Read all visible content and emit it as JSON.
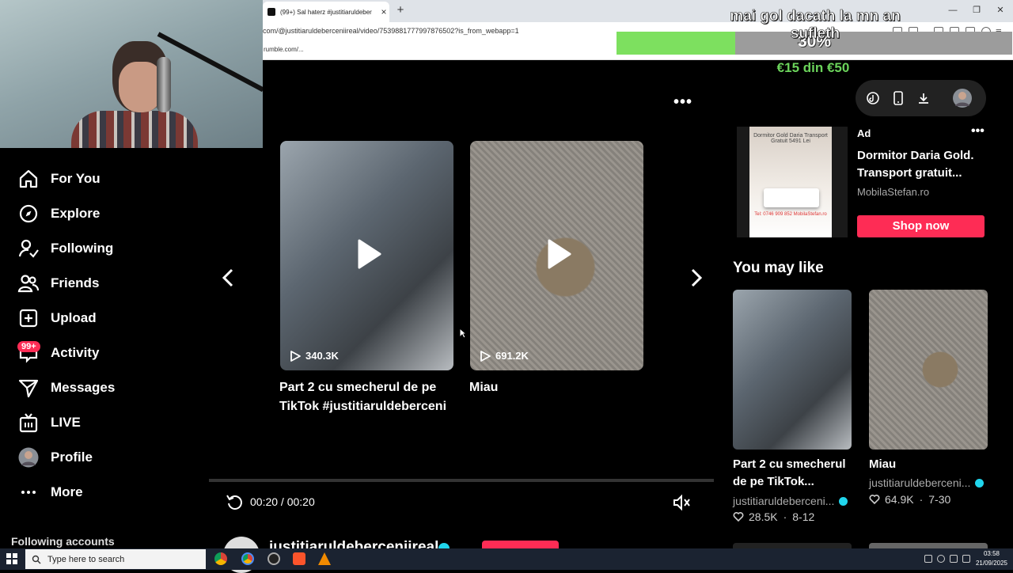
{
  "browser": {
    "tab_title": "(99+) Sal haterz #justitiaruldeber",
    "url": "com/@justitiaruldeberceniireal/video/7539881777997876502?is_from_webapp=1",
    "bookmark": "rumble.com/..."
  },
  "overlay": {
    "title": "mai gol dacath la mn an sufleth",
    "goal_percent": "30%",
    "goal_fraction": 0.3,
    "goal_amount": "€15 din €50"
  },
  "sidebar": {
    "items": [
      {
        "label": "For You",
        "icon": "home-icon"
      },
      {
        "label": "Explore",
        "icon": "compass-icon"
      },
      {
        "label": "Following",
        "icon": "following-icon"
      },
      {
        "label": "Friends",
        "icon": "friends-icon"
      },
      {
        "label": "Upload",
        "icon": "upload-icon"
      },
      {
        "label": "Activity",
        "icon": "activity-icon"
      },
      {
        "label": "Messages",
        "icon": "messages-icon"
      },
      {
        "label": "LIVE",
        "icon": "live-icon"
      },
      {
        "label": "Profile",
        "icon": "avatar"
      },
      {
        "label": "More",
        "icon": "more-icon"
      }
    ],
    "activity_badge": "99+",
    "following_header": "Following accounts"
  },
  "player": {
    "videos": [
      {
        "views": "340.3K",
        "caption_line1": "Part 2 cu smecherul de pe",
        "caption_line2": "TikTok #justitiaruldeberceni"
      },
      {
        "views": "691.2K",
        "caption_line1": "Miau",
        "caption_line2": ""
      }
    ],
    "time": "00:20 / 00:20",
    "author": "justitiaruldeberceniireal"
  },
  "ad": {
    "label": "Ad",
    "title": "Dormitor Daria Gold. Transport gratuit...",
    "brand": "MobilaStefan.ro",
    "cta": "Shop now",
    "image_text": "Dormitor Gold Daria Transport Gratuit 5491 Lei",
    "image_contact": "Tel: 0746 909 852 MobilaStefan.ro"
  },
  "recommendations": {
    "header": "You may like",
    "items": [
      {
        "title_line1": "Part 2 cu smecherul",
        "title_line2": "de pe TikTok...",
        "author": "justitiaruldeberceni...",
        "likes": "28.5K",
        "date": "8-12"
      },
      {
        "title_line1": "Miau",
        "title_line2": "",
        "author": "justitiaruldeberceni...",
        "likes": "64.9K",
        "date": "7-30"
      }
    ]
  },
  "taskbar": {
    "search_placeholder": "Type here to search",
    "time": "03:58",
    "date": "21/09/2025"
  },
  "colors": {
    "accent": "#fe2c55",
    "goal_green": "#7de05f",
    "verified": "#20d5ec"
  }
}
